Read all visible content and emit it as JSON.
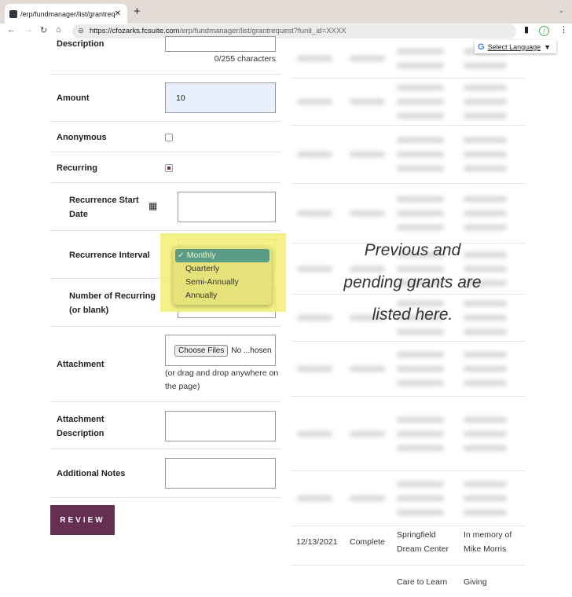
{
  "browser": {
    "tab_title": "/erp/fundmanager/list/grantreq",
    "url_host": "https://cfozarks.fcsuite.com",
    "url_path": "/erp/fundmanager/list/grantrequest?funit_id=XXXX"
  },
  "translate": {
    "label": "Select Language"
  },
  "form": {
    "description_label": "Description",
    "description_counter": "0/255 characters",
    "amount_label": "Amount",
    "amount_value": "10",
    "anonymous_label": "Anonymous",
    "anonymous_checked": false,
    "recurring_label": "Recurring",
    "recurring_checked": true,
    "recurrence_start_label": "Recurrence Start Date",
    "recurrence_interval_label": "Recurrence Interval",
    "interval_options": [
      "Monthly",
      "Quarterly",
      "Semi-Annually",
      "Annually"
    ],
    "interval_selected": "Monthly",
    "number_recurring_label": "Number of Recurring (or blank)",
    "attachment_label": "Attachment",
    "choose_files": "Choose Files",
    "no_file": "No ...hosen",
    "attachment_hint": "(or drag and drop anywhere on the page)",
    "attachment_description_label": "Attachment Description",
    "additional_notes_label": "Additional Notes",
    "review_button": "REVIEW"
  },
  "grants": {
    "overlay_text": "Previous and pending grants are listed here.",
    "visible_rows": [
      {
        "date": "12/13/2021",
        "status": "Complete",
        "organization": "Springfield Dream Center",
        "note": "In memory of Mike Morris"
      },
      {
        "date": "",
        "status": "",
        "organization": "Care to Learn",
        "note": "Giving"
      }
    ]
  },
  "colors": {
    "accent": "#642f52",
    "highlight": "#f3f07a",
    "selected_option": "#5a9c85"
  }
}
